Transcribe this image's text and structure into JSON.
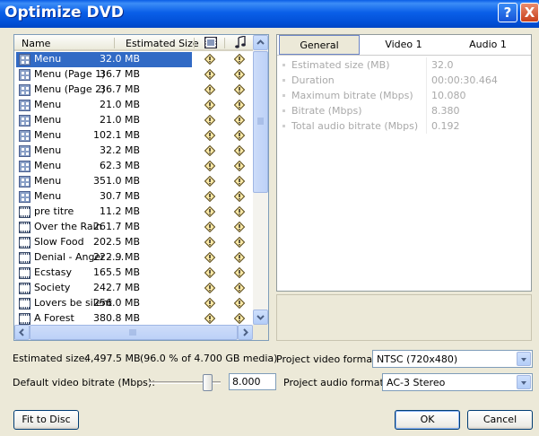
{
  "window": {
    "title": "Optimize DVD",
    "help_glyph": "?",
    "close_glyph": "X"
  },
  "list": {
    "columns": {
      "name": "Name",
      "size": "Estimated Size"
    },
    "column_icons": [
      "film-icon",
      "music-note-icon"
    ],
    "rows": [
      {
        "name": "Menu",
        "size": "32.0 MB",
        "type": "menu",
        "selected": true
      },
      {
        "name": "Menu (Page 1)",
        "size": "36.7 MB",
        "type": "menu"
      },
      {
        "name": "Menu (Page 2)",
        "size": "36.7 MB",
        "type": "menu"
      },
      {
        "name": "Menu",
        "size": "21.0 MB",
        "type": "menu"
      },
      {
        "name": "Menu",
        "size": "21.0 MB",
        "type": "menu"
      },
      {
        "name": "Menu",
        "size": "102.1 MB",
        "type": "menu"
      },
      {
        "name": "Menu",
        "size": "32.2 MB",
        "type": "menu"
      },
      {
        "name": "Menu",
        "size": "62.3 MB",
        "type": "menu"
      },
      {
        "name": "Menu",
        "size": "351.0 MB",
        "type": "menu"
      },
      {
        "name": "Menu",
        "size": "30.7 MB",
        "type": "menu"
      },
      {
        "name": "pre titre",
        "size": "11.2 MB",
        "type": "movie"
      },
      {
        "name": "Over the Rain",
        "size": "261.7 MB",
        "type": "movie"
      },
      {
        "name": "Slow Food",
        "size": "202.5 MB",
        "type": "movie"
      },
      {
        "name": "Denial - Anger - ...",
        "size": "222.9 MB",
        "type": "movie"
      },
      {
        "name": "Ecstasy",
        "size": "165.5 MB",
        "type": "movie"
      },
      {
        "name": "Society",
        "size": "242.7 MB",
        "type": "movie"
      },
      {
        "name": "Lovers be silent",
        "size": "256.0 MB",
        "type": "movie"
      },
      {
        "name": "A Forest",
        "size": "380.8 MB",
        "type": "movie"
      }
    ]
  },
  "tabs": [
    {
      "label": "General",
      "active": true
    },
    {
      "label": "Video 1",
      "active": false
    },
    {
      "label": "Audio 1",
      "active": false
    }
  ],
  "properties": [
    {
      "label": "Estimated size (MB)",
      "value": "32.0"
    },
    {
      "label": "Duration",
      "value": "00:00:30.464"
    },
    {
      "label": "Maximum bitrate (Mbps)",
      "value": "10.080"
    },
    {
      "label": "Bitrate (Mbps)",
      "value": "8.380"
    },
    {
      "label": "Total audio bitrate (Mbps)",
      "value": "0.192"
    }
  ],
  "summary": {
    "estimated_size_label": "Estimated size:",
    "estimated_size_value": "4,497.5 MB",
    "estimated_size_detail": "(96.0 % of 4.700 GB media)"
  },
  "bitrate": {
    "label": "Default video bitrate (Mbps):",
    "value": "8.000"
  },
  "video_format": {
    "label": "Project video format:",
    "value": "NTSC (720x480)"
  },
  "audio_format": {
    "label": "Project audio format:",
    "value": "AC-3 Stereo"
  },
  "buttons": {
    "fit": "Fit to Disc",
    "ok": "OK",
    "cancel": "Cancel"
  }
}
